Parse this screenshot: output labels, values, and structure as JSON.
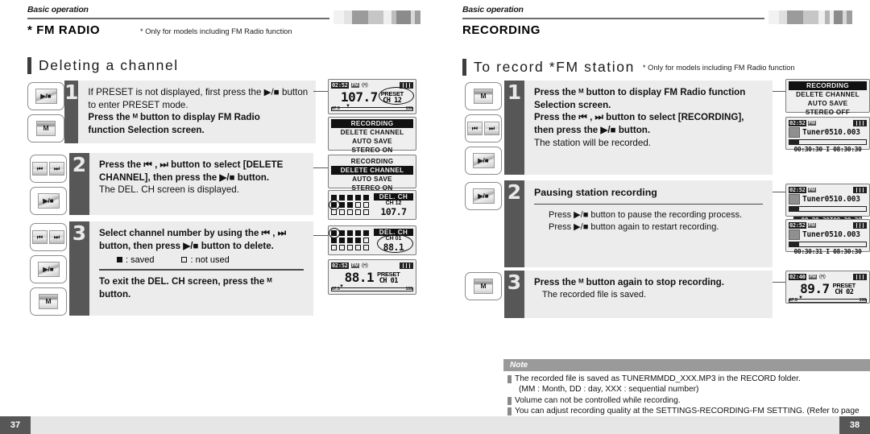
{
  "left": {
    "header": {
      "eyebrow": "Basic operation",
      "title": "FM RADIO",
      "star": "*",
      "note": "* Only for models including FM Radio function"
    },
    "section": {
      "title": "Deleting a channel"
    },
    "steps": [
      {
        "num": "1",
        "keys": [
          "play-stop",
          "m"
        ],
        "lines": [
          {
            "text": "If PRESET is not displayed, first press the  ▶/■  button",
            "style": "normal"
          },
          {
            "text": "to enter PRESET mode.",
            "style": "normal"
          },
          {
            "text": "Press the  ᴹ  button to display FM Radio",
            "style": "bold"
          },
          {
            "text": "function Selection screen.",
            "style": "bold"
          }
        ]
      },
      {
        "num": "2",
        "keys": [
          "prev-next",
          "play-stop"
        ],
        "lines": [
          {
            "text": "Press the ⏮ ,  ⏭ button to select [DELETE",
            "style": "bold"
          },
          {
            "text": "CHANNEL], then press the  ▶/■ button.",
            "style": "bold"
          },
          {
            "text": "The DEL. CH screen is displayed.",
            "style": "normal"
          }
        ]
      },
      {
        "num": "3",
        "keys": [
          "prev-next",
          "play-stop",
          "m"
        ],
        "lines": [
          {
            "text": "Select channel number by using the ⏮ ,  ⏭",
            "style": "bold"
          },
          {
            "text": "button, then press ▶/■ button to delete.",
            "style": "bold"
          }
        ],
        "legend": [
          {
            "icon": "filled-square",
            "label": ": saved"
          },
          {
            "icon": "empty-square",
            "label": ": not used"
          }
        ],
        "after": [
          {
            "text": "To exit the DEL. CH screen, press the ᴹ",
            "style": "bold"
          },
          {
            "text": "button.",
            "style": "bold"
          }
        ]
      }
    ],
    "screens": {
      "radio1": {
        "time": "02:52",
        "ampm": "PM",
        "antenna": "((•))",
        "freq": "107.7",
        "preset_label": "PRESET",
        "preset_ch": "CH 12",
        "scale_lo": "87.5",
        "scale_hi": "108"
      },
      "menu1": {
        "rows": [
          "RECORDING",
          "DELETE CHANNEL",
          "AUTO SAVE",
          "STEREO ON"
        ],
        "selected": -1,
        "inverted_first": true
      },
      "menu2": {
        "rows": [
          "RECORDING",
          "DELETE CHANNEL",
          "AUTO SAVE",
          "STEREO ON"
        ],
        "selected": 1
      },
      "del1": {
        "title": "DEL. CH",
        "ch": "CH 12",
        "freq": "107.7",
        "cells": [
          1,
          1,
          1,
          1,
          1,
          1,
          1,
          1,
          0,
          0,
          0,
          0,
          0,
          0,
          0
        ],
        "highlight_index": 5
      },
      "del2": {
        "title": "DEL. CH",
        "ch": "CH 01",
        "freq": "88.1",
        "cells": [
          1,
          1,
          1,
          1,
          1,
          1,
          1,
          1,
          1,
          0,
          0,
          0,
          0,
          0,
          0
        ],
        "highlight_index": 0
      },
      "radio2": {
        "time": "02:52",
        "ampm": "PM",
        "antenna": "((•))",
        "freq": "88.1",
        "preset_label": "PRESET",
        "preset_ch": "CH 01",
        "scale_lo": "87.5",
        "scale_hi": "108"
      }
    },
    "page_number": "37"
  },
  "right": {
    "header": {
      "eyebrow": "Basic operation",
      "title": "RECORDING"
    },
    "section": {
      "title": "To record *FM station",
      "sub": "* Only for models including FM Radio function"
    },
    "steps": [
      {
        "num": "1",
        "keys": [
          "m",
          "prev-next",
          "play-stop"
        ],
        "lines": [
          {
            "text": "Press the ᴹ button to display FM Radio function",
            "style": "bold"
          },
          {
            "text": "Selection screen.",
            "style": "bold"
          },
          {
            "text": "Press the ⏮ ,  ⏭ button to select [RECORDING],",
            "style": "bold"
          },
          {
            "text": "then press the  ▶/■ button.",
            "style": "bold"
          },
          {
            "text": "The station will be recorded.",
            "style": "normal"
          }
        ]
      },
      {
        "num": "2",
        "keys": [
          "play-stop"
        ],
        "heading": "Pausing station recording",
        "lines": [
          {
            "text": "Press  ▶/■ button to pause the recording process.",
            "style": "normal"
          },
          {
            "text": "Press  ▶/■ button again to restart recording.",
            "style": "normal"
          }
        ]
      },
      {
        "num": "3",
        "keys": [
          "m"
        ],
        "lines": [
          {
            "text": "Press the ᴹ button again to stop recording.",
            "style": "bold"
          },
          {
            "text": "The recorded file is saved.",
            "style": "normal"
          }
        ]
      }
    ],
    "screens": {
      "menu1": {
        "rows": [
          "RECORDING",
          "DELETE CHANNEL",
          "AUTO SAVE",
          "STEREO OFF"
        ],
        "selected": 0
      },
      "rec1": {
        "time": "02:52",
        "file": "Tuner0510.003",
        "progress": 8,
        "elapsed": "00:30:30",
        "separator": "I",
        "total": "08:30:30",
        "paused": false
      },
      "rec2": {
        "time": "02:52",
        "file": "Tuner0510.003",
        "progress": 8,
        "elapsed": "--00:30:30",
        "separator": "I",
        "total": "08:30:30",
        "paused": true
      },
      "rec3": {
        "time": "02:52",
        "file": "Tuner0510.003",
        "progress": 8,
        "elapsed": "00:30:31",
        "separator": "I",
        "total": "08:30:30",
        "paused": false
      },
      "radio3": {
        "time": "02:40",
        "ampm": "PM",
        "antenna": "((•))",
        "freq": "89.7",
        "preset_label": "PRESET",
        "preset_ch": "CH 02",
        "scale_lo": "87.5",
        "scale_hi": "108"
      }
    },
    "note": {
      "label": "Note",
      "items": [
        "The recorded file is saved as TUNERMMDD_XXX.MP3 in the RECORD  folder.",
        "Volume can not be controlled while recording.",
        "You can adjust recording quality at the SETTINGS-RECORDING-FM SETTING. (Refer to page"
      ],
      "sub_item": "(MM : Month, DD : day, XXX : sequential number)"
    },
    "page_number": "38"
  },
  "colors": {
    "step_num_bg": "#575757",
    "step_body_bg": "#ececec",
    "rule": "#6d6d6d",
    "note_hdr_bg": "#9a9a9a",
    "footer_bg": "#e6e6e6",
    "footer_num_bg": "#575757"
  }
}
